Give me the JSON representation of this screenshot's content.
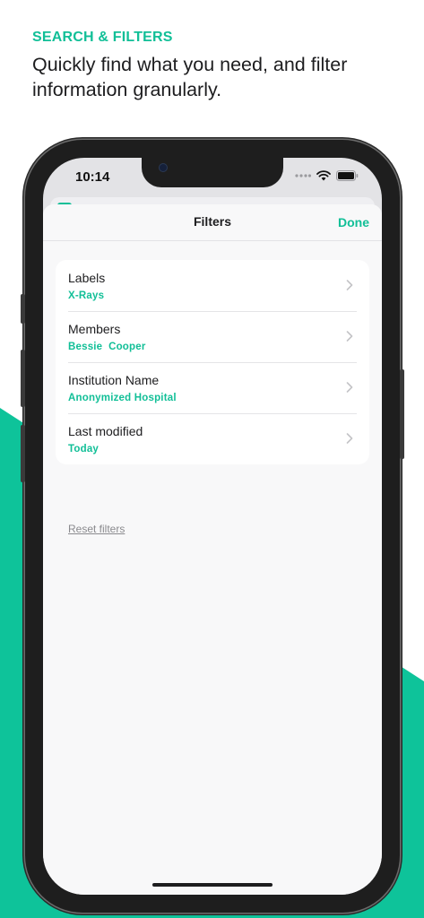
{
  "promo": {
    "title": "SEARCH & FILTERS",
    "subtitle": "Quickly find what you need, and filter information granularly."
  },
  "status_bar": {
    "time": "10:14",
    "icons": [
      "signal-dots-icon",
      "wifi-icon",
      "battery-icon"
    ]
  },
  "nav": {
    "title": "Filters",
    "done_label": "Done"
  },
  "filters": [
    {
      "label": "Labels",
      "value": "X-Rays"
    },
    {
      "label": "Members",
      "value": "Bessie  Cooper"
    },
    {
      "label": "Institution Name",
      "value": "Anonymized Hospital"
    },
    {
      "label": "Last modified",
      "value": "Today"
    }
  ],
  "reset_label": "Reset filters",
  "colors": {
    "accent": "#11bf97",
    "background_shape": "#0ec39a",
    "text_primary": "#1d1d1f",
    "text_secondary": "#8a8a8e"
  }
}
